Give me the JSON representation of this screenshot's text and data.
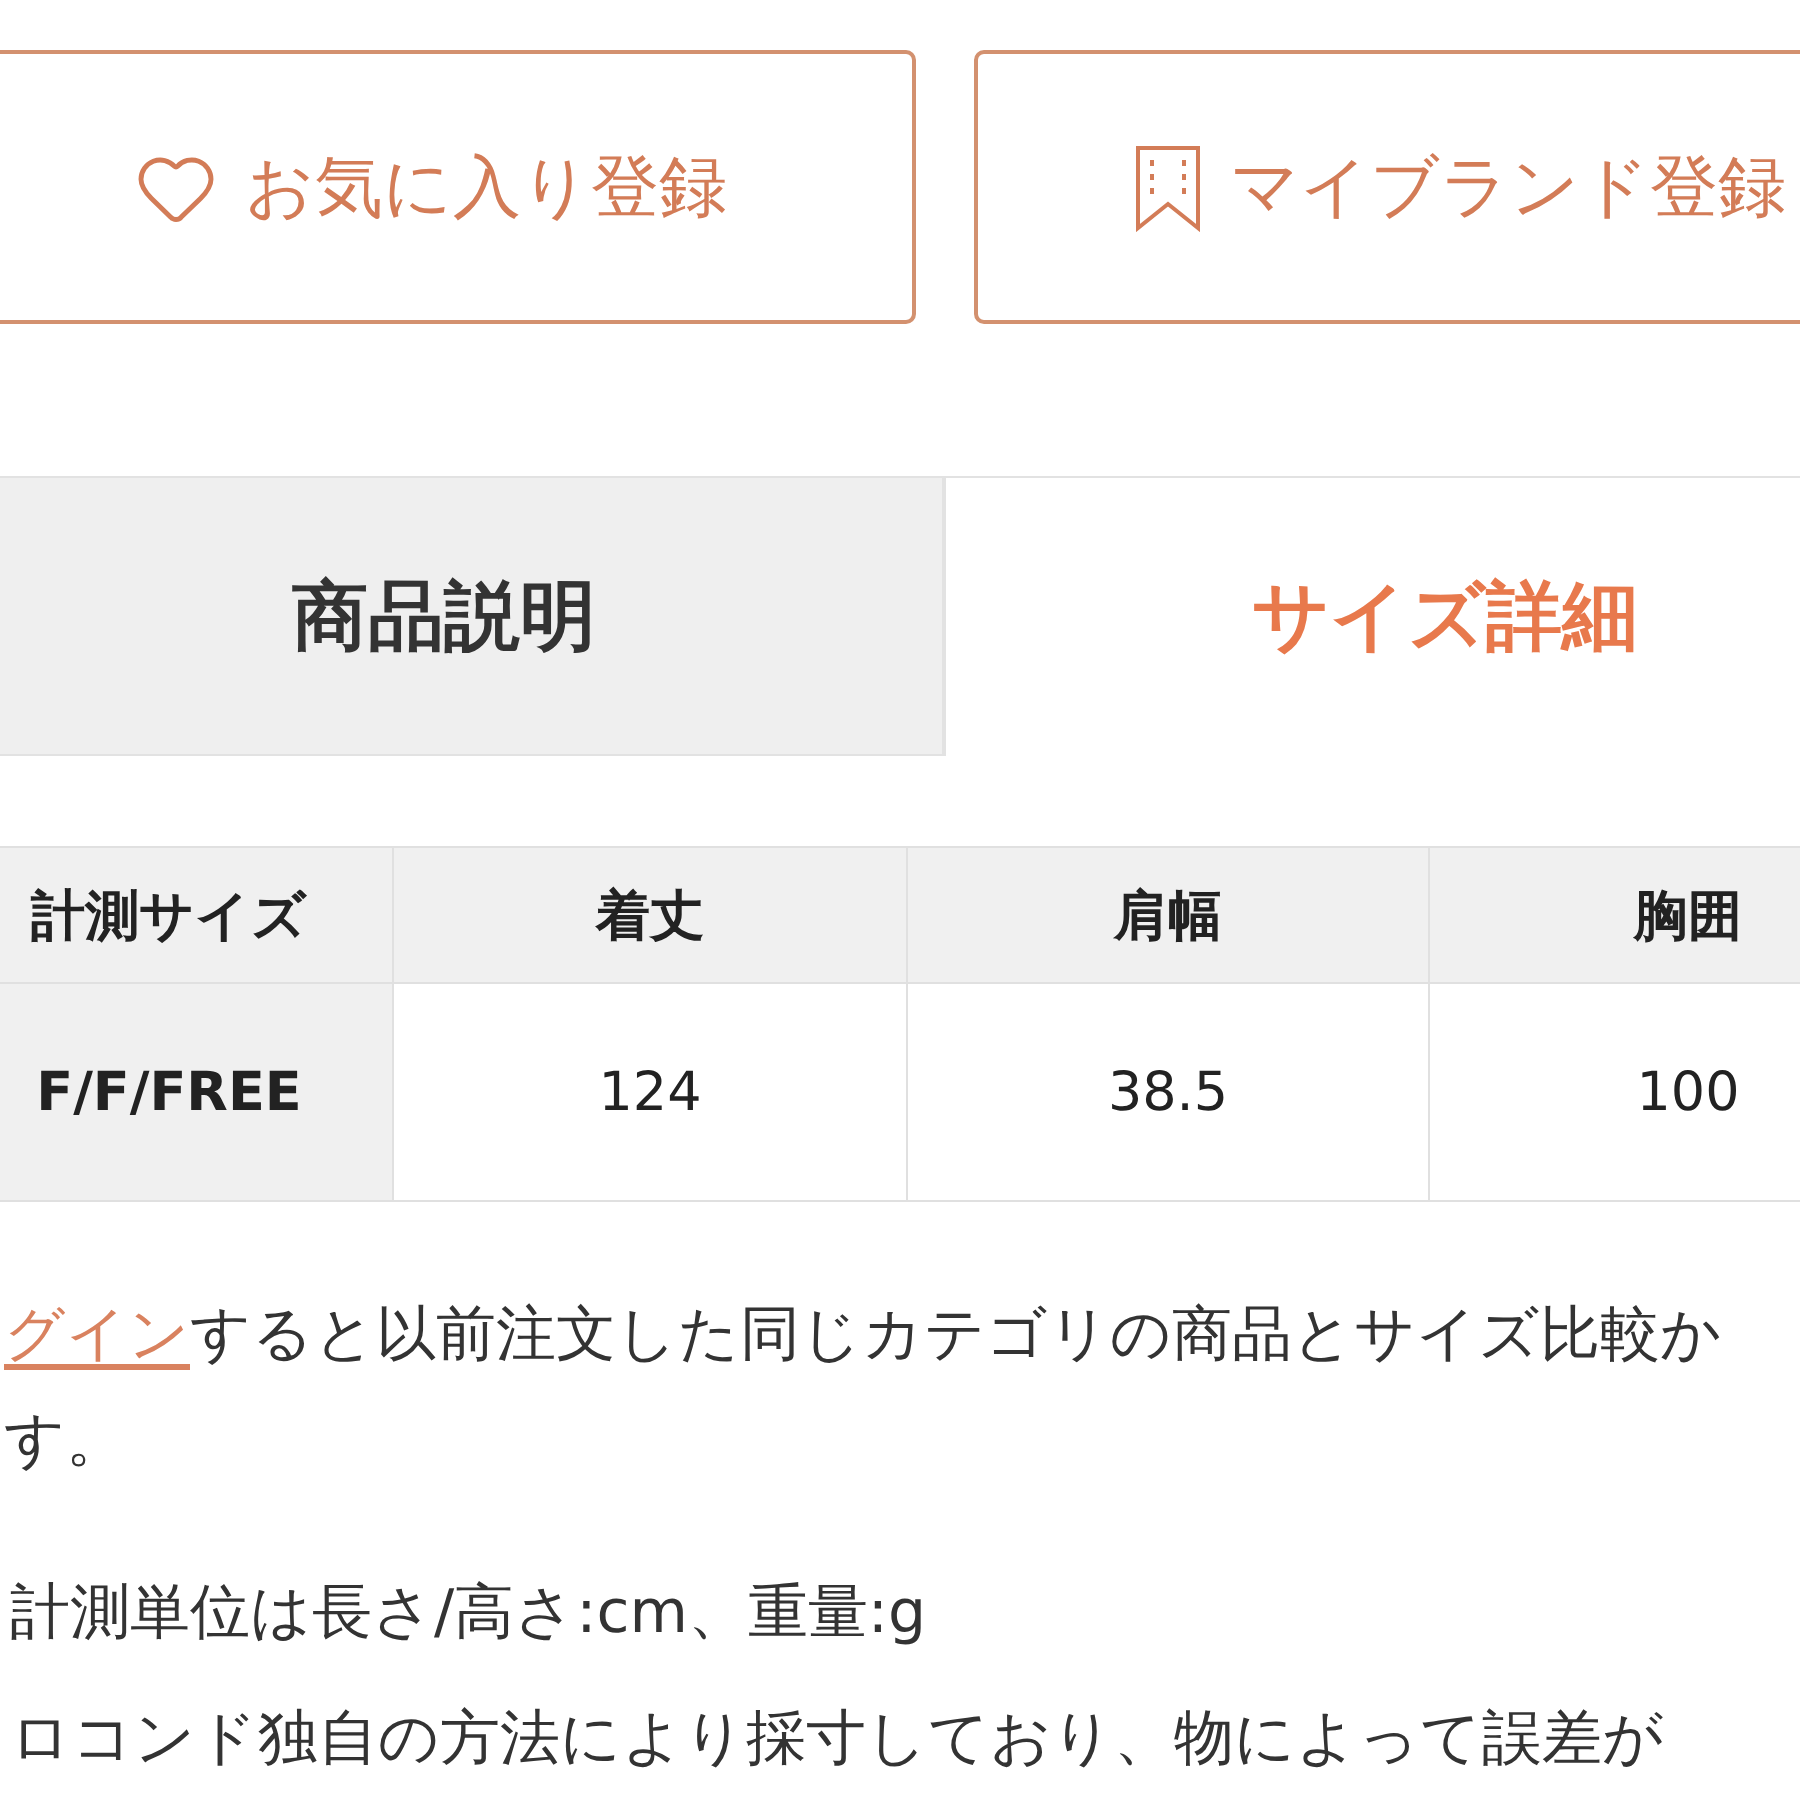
{
  "actions": [
    {
      "kind": "favorite",
      "label": "お気に入り登録"
    },
    {
      "kind": "brand",
      "label": "マイブランド登録"
    }
  ],
  "tabs": [
    {
      "label": "商品説明",
      "selected": false
    },
    {
      "label": "サイズ詳細",
      "selected": true
    }
  ],
  "size_table": {
    "columns": [
      "計測サイズ",
      "着丈",
      "肩幅",
      "胸囲"
    ],
    "rows": [
      [
        "F/F/FREE",
        "124",
        "38.5",
        "100"
      ]
    ]
  },
  "login_note": {
    "link": "グイン",
    "text": "すると以前注文した同じカテゴリの商品とサイズ比較か",
    "continuation": "す。"
  },
  "notes": [
    "計測単位は長さ/高さ:cm、重量:g",
    "ロコンド独自の方法により採寸しており、物によって誤差が"
  ]
}
